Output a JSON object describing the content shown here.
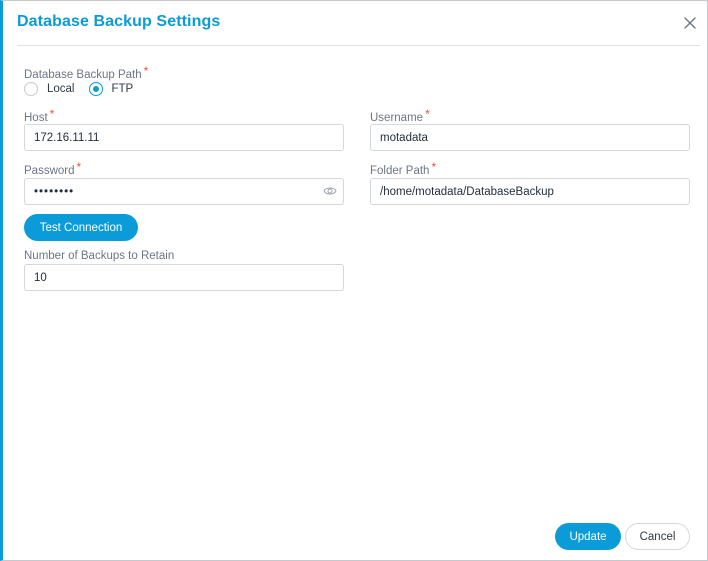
{
  "dialog": {
    "title": "Database Backup Settings",
    "close_icon": "close-icon"
  },
  "backup_path": {
    "label": "Database Backup Path",
    "required_mark": "*",
    "options": [
      {
        "label": "Local",
        "checked": false
      },
      {
        "label": "FTP",
        "checked": true
      }
    ]
  },
  "host": {
    "label": "Host",
    "required_mark": "*",
    "value": "172.16.11.11"
  },
  "username": {
    "label": "Username",
    "required_mark": "*",
    "value": "motadata"
  },
  "password": {
    "label": "Password",
    "required_mark": "*",
    "value": "••••••••",
    "toggle_icon": "eye-icon"
  },
  "folder_path": {
    "label": "Folder Path",
    "required_mark": "*",
    "value": "/home/motadata/DatabaseBackup"
  },
  "test_connection": {
    "label": "Test Connection"
  },
  "backups_to_retain": {
    "label": "Number of Backups to Retain",
    "value": "10"
  },
  "footer": {
    "update_label": "Update",
    "cancel_label": "Cancel"
  },
  "colors": {
    "accent": "#0b9bd8",
    "required": "#f0512f"
  }
}
